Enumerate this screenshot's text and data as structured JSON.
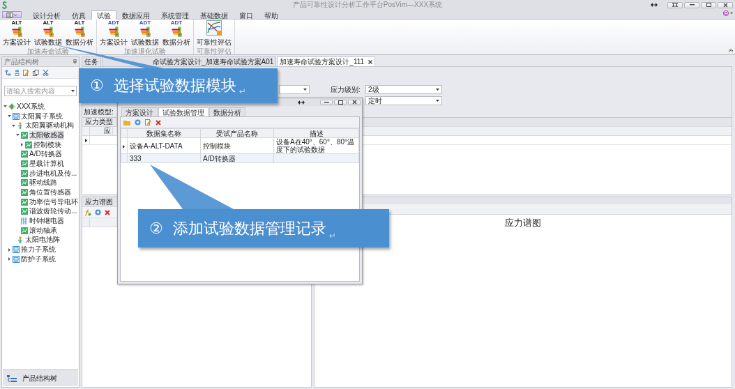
{
  "window": {
    "title": "产品可靠性设计分析工作平台PosVim—XXX系统"
  },
  "ribbon": {
    "tabs": [
      {
        "label": "设计分析",
        "selected": false
      },
      {
        "label": "仿真",
        "selected": false
      },
      {
        "label": "试验",
        "selected": true
      },
      {
        "label": "数据应用",
        "selected": false
      },
      {
        "label": "系统管理",
        "selected": false
      },
      {
        "label": "基础数据",
        "selected": false
      },
      {
        "label": "窗口",
        "selected": false
      },
      {
        "label": "帮助",
        "selected": false
      }
    ],
    "groups": [
      {
        "title": "加速寿命试验",
        "buttons": [
          {
            "label": "方案设计",
            "kind": "alt",
            "badge": "ALT"
          },
          {
            "label": "试验数据",
            "kind": "alt",
            "badge": "ALT"
          },
          {
            "label": "数据分析",
            "kind": "alt",
            "badge": "ALT"
          }
        ]
      },
      {
        "title": "加速退化试验",
        "buttons": [
          {
            "label": "方案设计",
            "kind": "adt",
            "badge": "ADT"
          },
          {
            "label": "试验数据",
            "kind": "adt",
            "badge": "ADT"
          },
          {
            "label": "数据分析",
            "kind": "adt",
            "badge": "ADT"
          }
        ]
      },
      {
        "title": "可靠性评估",
        "buttons": [
          {
            "label": "可靠性评估",
            "kind": "curve"
          }
        ]
      }
    ]
  },
  "sidebar": {
    "title": "产品结构树",
    "search": {
      "placeholder": "请输入搜索内容"
    },
    "tree": [
      {
        "label": "XXX系统",
        "kind": "root",
        "expanded": true,
        "selected": false,
        "children": [
          {
            "label": "太阳翼子系统",
            "kind": "system",
            "expanded": true,
            "selected": false,
            "children": [
              {
                "label": "太阳翼驱动机构",
                "kind": "assembly",
                "expanded": true,
                "selected": false,
                "children": [
                  {
                    "label": "太阳敏感器",
                    "kind": "component",
                    "expanded": true,
                    "selected": true,
                    "children": [
                      {
                        "label": "控制模块",
                        "kind": "component",
                        "expanded": false,
                        "selected": false
                      }
                    ]
                  },
                  {
                    "label": "A/D转换器",
                    "kind": "component",
                    "selected": false
                  },
                  {
                    "label": "星载计算机",
                    "kind": "component",
                    "selected": false
                  },
                  {
                    "label": "步进电机及传...",
                    "kind": "component",
                    "selected": false
                  },
                  {
                    "label": "驱动线路",
                    "kind": "component",
                    "selected": false
                  },
                  {
                    "label": "角位置传感器",
                    "kind": "component",
                    "selected": false
                  },
                  {
                    "label": "功率信号导电环",
                    "kind": "component",
                    "selected": false
                  },
                  {
                    "label": "谐波齿轮传动...",
                    "kind": "component",
                    "selected": false
                  },
                  {
                    "label": "时钟继电器",
                    "kind": "relay",
                    "selected": false
                  },
                  {
                    "label": "滚动轴承",
                    "kind": "component",
                    "selected": false
                  }
                ]
              },
              {
                "label": "太阳电池阵",
                "kind": "assembly",
                "selected": false
              }
            ]
          },
          {
            "label": "推力子系统",
            "kind": "system",
            "expanded": false,
            "selected": false
          },
          {
            "label": "防护子系统",
            "kind": "system",
            "expanded": false,
            "selected": false
          }
        ]
      }
    ],
    "footer": "产品结构树"
  },
  "documents": {
    "tabs": [
      {
        "label": "任务",
        "selected": false
      },
      {
        "label": "命试验方案设计_加速寿命试验方案A01",
        "selected": false
      },
      {
        "label": "加速寿命试验方案设计_111",
        "selected": true
      }
    ]
  },
  "form": {
    "stress_level": {
      "label": "应力级别:",
      "value": "2级"
    },
    "field_2": {
      "value": "定时"
    },
    "model_label": "加速模型:"
  },
  "stress_grid": {
    "group": "应力类型",
    "column": "应",
    "rows": [
      {
        "current": true
      }
    ]
  },
  "spectrum_panel": {
    "title": "应力谱图"
  },
  "chart_area": {
    "title": "应力谱图"
  },
  "dialog": {
    "tabs": [
      {
        "label": "方案设计",
        "selected": false
      },
      {
        "label": "试验数据管理",
        "selected": true
      },
      {
        "label": "数据分析",
        "selected": false
      }
    ],
    "table": {
      "columns": [
        "数据集名称",
        "受试产品名称",
        "描述"
      ],
      "rows": [
        {
          "cells": [
            "设备A-ALT-DATA",
            "控制模块",
            "设备A在40°、60°、80°温度下的试验数据"
          ],
          "selected": true
        },
        {
          "cells": [
            "333",
            "A/D转换器"
          ],
          "selected": false
        }
      ]
    }
  },
  "callouts": [
    {
      "number": "①",
      "text": "选择试验数据模块",
      "mark": "↵"
    },
    {
      "number": "②",
      "text": "添加试验数据管理记录",
      "mark": "↵"
    }
  ]
}
